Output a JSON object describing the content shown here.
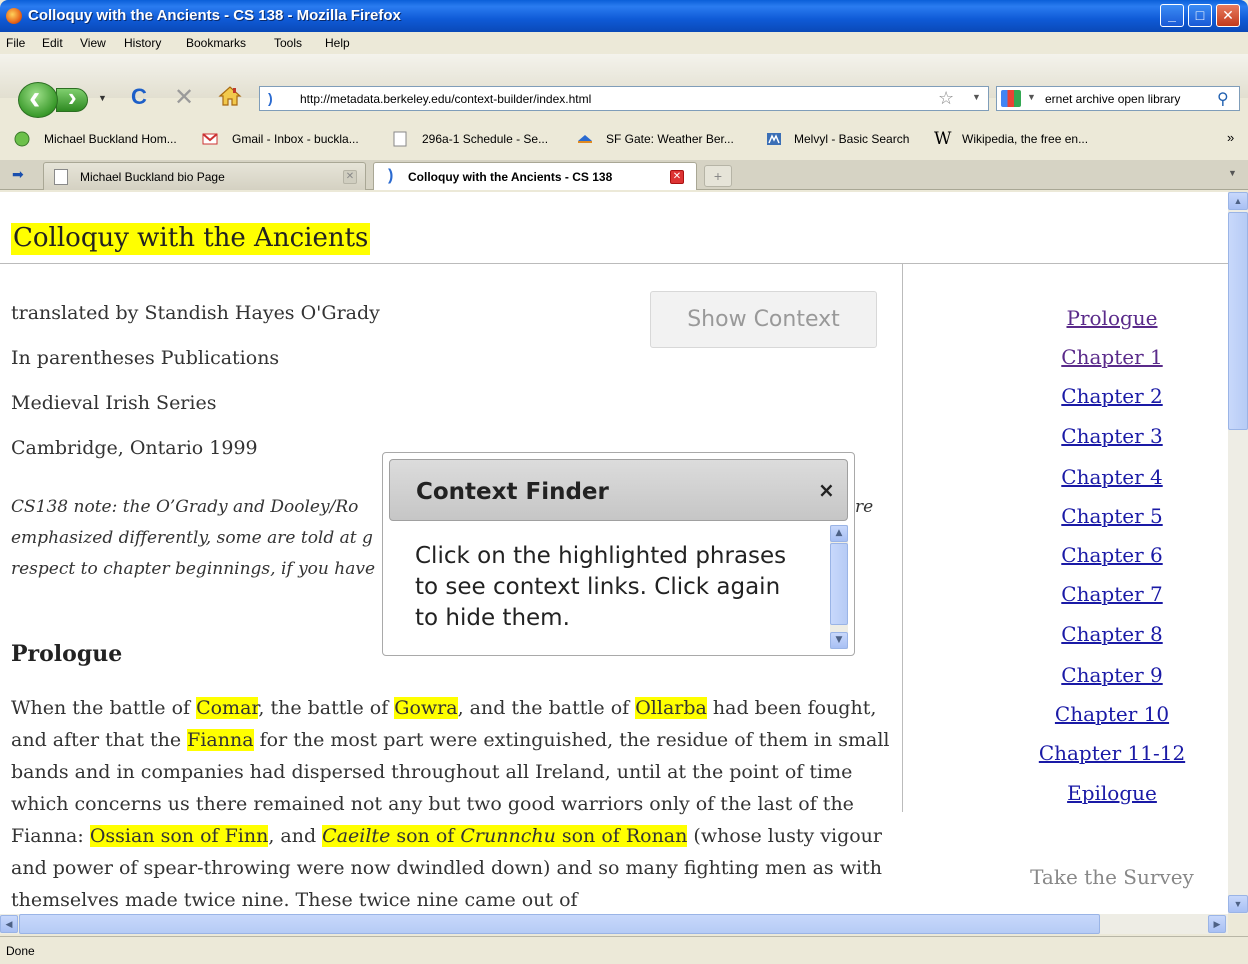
{
  "window": {
    "title": "Colloquy with the Ancients - CS 138 - Mozilla Firefox",
    "minimize": "_",
    "maximize": "□",
    "close": "✕"
  },
  "menu": [
    "File",
    "Edit",
    "View",
    "History",
    "Bookmarks",
    "Tools",
    "Help"
  ],
  "nav": {
    "url": "http://metadata.berkeley.edu/context-builder/index.html",
    "search_query": "ernet archive open library"
  },
  "bookmarks": [
    "Michael Buckland Hom...",
    "Gmail - Inbox - buckla...",
    "296a-1 Schedule - Se...",
    "SF Gate: Weather Ber...",
    "Melvyl - Basic Search",
    "Wikipedia, the free en..."
  ],
  "tabs": [
    {
      "label": "Michael Buckland bio Page",
      "active": false
    },
    {
      "label": "Colloquy with the Ancients - CS 138",
      "active": true
    }
  ],
  "page": {
    "title": "Colloquy with the Ancients",
    "meta": [
      "translated by Standish Hayes O'Grady",
      "In parentheses Publications",
      "Medieval Irish Series",
      "Cambridge, Ontario 1999"
    ],
    "show_context_label": "Show Context",
    "note_line1": "CS138 note: the O’Grady and Dooley/Ro",
    "note_line1_end": "re",
    "note_line2": "emphasized differently, some are told at g",
    "note_line3": "respect to chapter beginnings, if you have",
    "prologue_heading": "Prologue",
    "body": {
      "t1": "When the battle of ",
      "h1": "Comar",
      "t2": ", the battle of ",
      "h2": "Gowra",
      "t3": ", and the battle of ",
      "h3": "Ollarba",
      "t4": " had been fought, and after that the ",
      "h4": "Fianna",
      "t5": " for the most part were extinguished, the residue of them in small bands and in companies had dispersed throughout all Ireland, until at the point of time which concerns us there remained not any but two good warriors only of the last of the Fianna: ",
      "h5": "Ossian son of Finn",
      "t6": ", and ",
      "h6a": "Caeilte",
      "h6b": " son of ",
      "h6c": "Crunnchu",
      "h6d": " son of Ronan",
      "t7": " (whose lusty vigour and power of spear-throwing were now dwindled down) and so many fighting men as with themselves made twice nine. These twice nine came out of"
    }
  },
  "toc": [
    {
      "label": "Prologue",
      "visited": true
    },
    {
      "label": "Chapter 1",
      "visited": true
    },
    {
      "label": "Chapter 2",
      "visited": false
    },
    {
      "label": "Chapter 3",
      "visited": false
    },
    {
      "label": "Chapter 4",
      "visited": false
    },
    {
      "label": "Chapter 5",
      "visited": false
    },
    {
      "label": "Chapter 6",
      "visited": false
    },
    {
      "label": "Chapter 7",
      "visited": false
    },
    {
      "label": "Chapter 8",
      "visited": false
    },
    {
      "label": "Chapter 9",
      "visited": false
    },
    {
      "label": "Chapter 10",
      "visited": false
    },
    {
      "label": "Chapter 11-12",
      "visited": false
    },
    {
      "label": "Epilogue",
      "visited": false
    }
  ],
  "survey_label": "Take the Survey",
  "dialog": {
    "title": "Context Finder",
    "close": "×",
    "body": "Click on the highlighted phrases to see context links. Click again to hide them."
  },
  "status": "Done",
  "colors": {
    "highlight": "#ffff00",
    "titlebar": "#0a5fd8",
    "link": "#1a1aa6",
    "visited_link": "#5a2a8a"
  }
}
